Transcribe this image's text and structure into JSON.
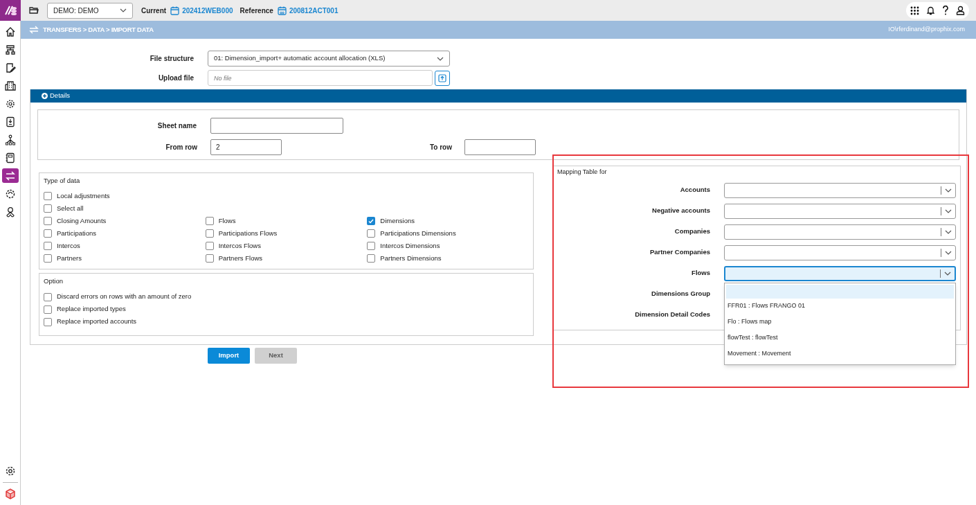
{
  "top_bar": {
    "entity_select": "DEMO: DEMO",
    "current_label": "Current",
    "current_value": "202412WEB000",
    "reference_label": "Reference",
    "reference_value": "200812ACT001"
  },
  "sidebar": {
    "items": [
      {
        "selected": false
      },
      {
        "selected": false
      },
      {
        "selected": false
      },
      {
        "selected": false
      },
      {
        "selected": false
      },
      {
        "selected": false
      },
      {
        "selected": false
      },
      {
        "selected": false
      },
      {
        "selected": true
      },
      {
        "selected": false
      },
      {
        "selected": false
      }
    ]
  },
  "breadcrumb": "TRANSFERS > DATA > IMPORT DATA",
  "user": "IO\\rferdinand@prophix.com",
  "file_structure": {
    "label": "File structure",
    "value": "01: Dimension_import+ automatic account allocation (XLS)"
  },
  "upload_file": {
    "label": "Upload file",
    "placeholder": "No file"
  },
  "details": {
    "title": "Details",
    "sheet_name_label": "Sheet name",
    "from_row_label": "From row",
    "from_row_value": "2",
    "to_row_label": "To row"
  },
  "type_of_data": {
    "title": "Type of data",
    "rows": [
      [
        {
          "label": "Local adjustments",
          "checked": false
        }
      ],
      [
        {
          "label": "Select all",
          "checked": false
        }
      ],
      [
        {
          "label": "Closing Amounts",
          "checked": false
        },
        {
          "label": "Flows",
          "checked": false
        },
        {
          "label": "Dimensions",
          "checked": true
        }
      ],
      [
        {
          "label": "Participations",
          "checked": false
        },
        {
          "label": "Participations Flows",
          "checked": false
        },
        {
          "label": "Participations Dimensions",
          "checked": false
        }
      ],
      [
        {
          "label": "Intercos",
          "checked": false
        },
        {
          "label": "Intercos Flows",
          "checked": false
        },
        {
          "label": "Intercos Dimensions",
          "checked": false
        }
      ],
      [
        {
          "label": "Partners",
          "checked": false
        },
        {
          "label": "Partners Flows",
          "checked": false
        },
        {
          "label": "Partners Dimensions",
          "checked": false
        }
      ]
    ]
  },
  "option": {
    "title": "Option",
    "items": [
      {
        "label": "Discard errors on rows with an amount of zero",
        "checked": false
      },
      {
        "label": "Replace imported types",
        "checked": false
      },
      {
        "label": "Replace imported accounts",
        "checked": false
      }
    ]
  },
  "mapping": {
    "title": "Mapping Table for",
    "fields": [
      {
        "label": "Accounts",
        "focused": false
      },
      {
        "label": "Negative accounts",
        "focused": false
      },
      {
        "label": "Companies",
        "focused": false
      },
      {
        "label": "Partner Companies",
        "focused": false
      },
      {
        "label": "Flows",
        "focused": true
      },
      {
        "label": "Dimensions Group",
        "focused": false
      },
      {
        "label": "Dimension Detail Codes",
        "focused": false
      }
    ],
    "dropdown_options": [
      "FFR01 : Flows FRANGO 01",
      "Flo : Flows map",
      "flowTest : flowTest",
      "Movement : Movement"
    ]
  },
  "buttons": [
    {
      "label": "Import",
      "disabled": false
    },
    {
      "label": "Next",
      "disabled": true
    }
  ]
}
